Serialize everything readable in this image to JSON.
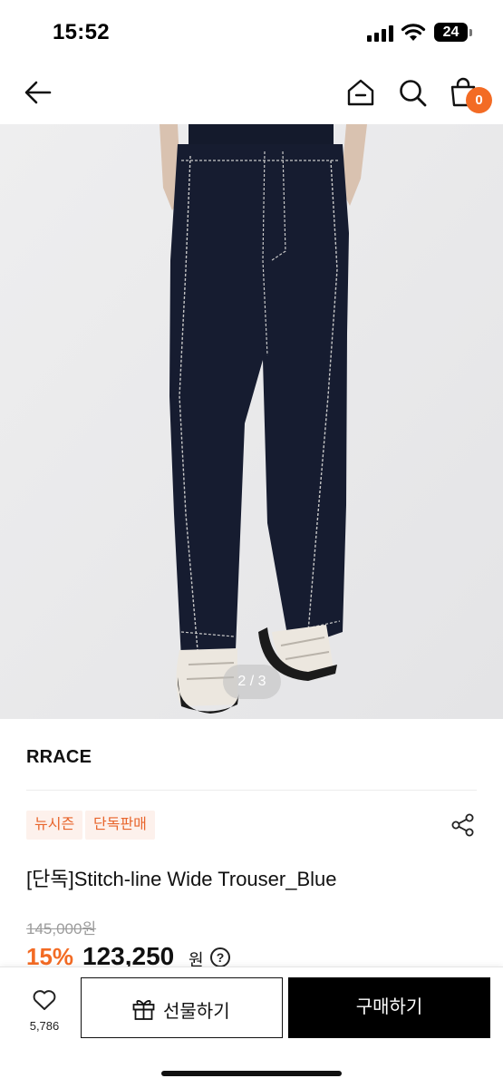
{
  "status_bar": {
    "time": "15:52",
    "battery": "24"
  },
  "nav": {
    "back_icon": "arrow-left-icon",
    "home_icon": "home-icon",
    "search_icon": "search-icon",
    "cart_icon": "shopping-bag-icon",
    "cart_count": "0",
    "accent_color": "#f36b24"
  },
  "gallery": {
    "counter": "2 / 3",
    "current": 2,
    "total": 3
  },
  "product": {
    "brand": "RRACE",
    "tags": [
      "뉴시즌",
      "단독판매"
    ],
    "title": "[단독]Stitch-line Wide Trouser_Blue",
    "original_price": "145,000원",
    "discount_rate": "15%",
    "sale_price": "123,250",
    "currency_unit": "원",
    "info_symbol": "?"
  },
  "actions": {
    "like_count": "5,786",
    "gift_label": "선물하기",
    "buy_label": "구매하기"
  }
}
